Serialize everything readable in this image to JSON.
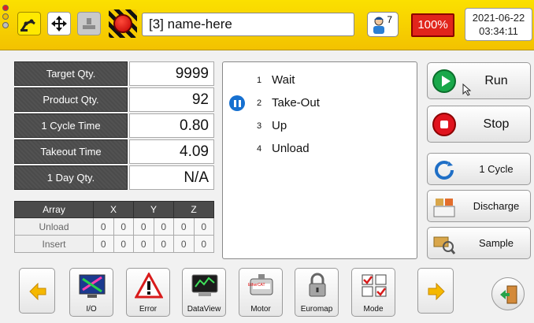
{
  "topbar": {
    "program_name": "[3] name-here",
    "user_level": "7",
    "speed": "100%",
    "date": "2021-06-22",
    "time": "03:34:11",
    "icons": [
      "status-lamp-icon",
      "robot-arm-icon",
      "move-cross-icon",
      "stack-icon",
      "emergency-stop-icon",
      "operator-icon"
    ],
    "colors": {
      "bar": "#f7d000",
      "speed_bg": "#e1251b"
    }
  },
  "stats": [
    {
      "label": "Target Qty.",
      "value": "9999"
    },
    {
      "label": "Product Qty.",
      "value": "92"
    },
    {
      "label": "1 Cycle Time",
      "value": "0.80"
    },
    {
      "label": "Takeout Time",
      "value": "4.09"
    },
    {
      "label": "1 Day Qty.",
      "value": "N/A"
    }
  ],
  "array": {
    "headers": [
      "Array",
      "X",
      "Y",
      "Z"
    ],
    "rows": [
      {
        "label": "Unload",
        "cells": [
          "0",
          "0",
          "0",
          "0",
          "0",
          "0"
        ]
      },
      {
        "label": "Insert",
        "cells": [
          "0",
          "0",
          "0",
          "0",
          "0",
          "0"
        ]
      }
    ]
  },
  "steps": [
    {
      "num": "1",
      "name": "Wait"
    },
    {
      "num": "2",
      "name": "Take-Out"
    },
    {
      "num": "3",
      "name": "Up"
    },
    {
      "num": "4",
      "name": "Unload"
    }
  ],
  "current_step": "2",
  "controls": {
    "run": "Run",
    "stop": "Stop",
    "cycle": "1 Cycle",
    "discharge": "Discharge",
    "sample": "Sample"
  },
  "toolbar": {
    "io": "I/O",
    "error": "Error",
    "dataview": "DataView",
    "motor": "Motor",
    "euromap": "Euromap",
    "mode": "Mode",
    "motor_brand": "EtherCAT"
  }
}
